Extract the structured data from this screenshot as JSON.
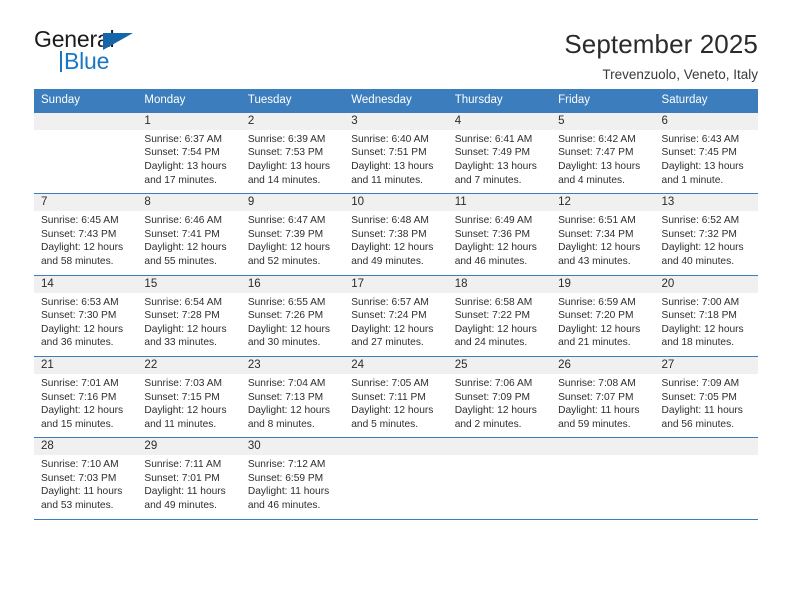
{
  "brand": {
    "name_top": "General",
    "name_bottom": "Blue",
    "accent_color": "#1878c4",
    "triangle_color": "#1565a8"
  },
  "header": {
    "title": "September 2025",
    "subtitle": "Trevenzuolo, Veneto, Italy"
  },
  "theme": {
    "header_row_bg": "#3b7dbd",
    "day_band_bg": "#f0f0f0",
    "cell_bg": "#ffffff",
    "text_color": "#2e2e2e"
  },
  "weekdays": [
    "Sunday",
    "Monday",
    "Tuesday",
    "Wednesday",
    "Thursday",
    "Friday",
    "Saturday"
  ],
  "calendar_data": {
    "type": "table",
    "title": "September 2025",
    "location": "Trevenzuolo, Veneto, Italy",
    "weeks": [
      [
        {
          "day": "",
          "sunrise": "",
          "sunset": "",
          "daylight_line1": "",
          "daylight_line2": ""
        },
        {
          "day": "1",
          "sunrise": "Sunrise: 6:37 AM",
          "sunset": "Sunset: 7:54 PM",
          "daylight_line1": "Daylight: 13 hours",
          "daylight_line2": "and 17 minutes."
        },
        {
          "day": "2",
          "sunrise": "Sunrise: 6:39 AM",
          "sunset": "Sunset: 7:53 PM",
          "daylight_line1": "Daylight: 13 hours",
          "daylight_line2": "and 14 minutes."
        },
        {
          "day": "3",
          "sunrise": "Sunrise: 6:40 AM",
          "sunset": "Sunset: 7:51 PM",
          "daylight_line1": "Daylight: 13 hours",
          "daylight_line2": "and 11 minutes."
        },
        {
          "day": "4",
          "sunrise": "Sunrise: 6:41 AM",
          "sunset": "Sunset: 7:49 PM",
          "daylight_line1": "Daylight: 13 hours",
          "daylight_line2": "and 7 minutes."
        },
        {
          "day": "5",
          "sunrise": "Sunrise: 6:42 AM",
          "sunset": "Sunset: 7:47 PM",
          "daylight_line1": "Daylight: 13 hours",
          "daylight_line2": "and 4 minutes."
        },
        {
          "day": "6",
          "sunrise": "Sunrise: 6:43 AM",
          "sunset": "Sunset: 7:45 PM",
          "daylight_line1": "Daylight: 13 hours",
          "daylight_line2": "and 1 minute."
        }
      ],
      [
        {
          "day": "7",
          "sunrise": "Sunrise: 6:45 AM",
          "sunset": "Sunset: 7:43 PM",
          "daylight_line1": "Daylight: 12 hours",
          "daylight_line2": "and 58 minutes."
        },
        {
          "day": "8",
          "sunrise": "Sunrise: 6:46 AM",
          "sunset": "Sunset: 7:41 PM",
          "daylight_line1": "Daylight: 12 hours",
          "daylight_line2": "and 55 minutes."
        },
        {
          "day": "9",
          "sunrise": "Sunrise: 6:47 AM",
          "sunset": "Sunset: 7:39 PM",
          "daylight_line1": "Daylight: 12 hours",
          "daylight_line2": "and 52 minutes."
        },
        {
          "day": "10",
          "sunrise": "Sunrise: 6:48 AM",
          "sunset": "Sunset: 7:38 PM",
          "daylight_line1": "Daylight: 12 hours",
          "daylight_line2": "and 49 minutes."
        },
        {
          "day": "11",
          "sunrise": "Sunrise: 6:49 AM",
          "sunset": "Sunset: 7:36 PM",
          "daylight_line1": "Daylight: 12 hours",
          "daylight_line2": "and 46 minutes."
        },
        {
          "day": "12",
          "sunrise": "Sunrise: 6:51 AM",
          "sunset": "Sunset: 7:34 PM",
          "daylight_line1": "Daylight: 12 hours",
          "daylight_line2": "and 43 minutes."
        },
        {
          "day": "13",
          "sunrise": "Sunrise: 6:52 AM",
          "sunset": "Sunset: 7:32 PM",
          "daylight_line1": "Daylight: 12 hours",
          "daylight_line2": "and 40 minutes."
        }
      ],
      [
        {
          "day": "14",
          "sunrise": "Sunrise: 6:53 AM",
          "sunset": "Sunset: 7:30 PM",
          "daylight_line1": "Daylight: 12 hours",
          "daylight_line2": "and 36 minutes."
        },
        {
          "day": "15",
          "sunrise": "Sunrise: 6:54 AM",
          "sunset": "Sunset: 7:28 PM",
          "daylight_line1": "Daylight: 12 hours",
          "daylight_line2": "and 33 minutes."
        },
        {
          "day": "16",
          "sunrise": "Sunrise: 6:55 AM",
          "sunset": "Sunset: 7:26 PM",
          "daylight_line1": "Daylight: 12 hours",
          "daylight_line2": "and 30 minutes."
        },
        {
          "day": "17",
          "sunrise": "Sunrise: 6:57 AM",
          "sunset": "Sunset: 7:24 PM",
          "daylight_line1": "Daylight: 12 hours",
          "daylight_line2": "and 27 minutes."
        },
        {
          "day": "18",
          "sunrise": "Sunrise: 6:58 AM",
          "sunset": "Sunset: 7:22 PM",
          "daylight_line1": "Daylight: 12 hours",
          "daylight_line2": "and 24 minutes."
        },
        {
          "day": "19",
          "sunrise": "Sunrise: 6:59 AM",
          "sunset": "Sunset: 7:20 PM",
          "daylight_line1": "Daylight: 12 hours",
          "daylight_line2": "and 21 minutes."
        },
        {
          "day": "20",
          "sunrise": "Sunrise: 7:00 AM",
          "sunset": "Sunset: 7:18 PM",
          "daylight_line1": "Daylight: 12 hours",
          "daylight_line2": "and 18 minutes."
        }
      ],
      [
        {
          "day": "21",
          "sunrise": "Sunrise: 7:01 AM",
          "sunset": "Sunset: 7:16 PM",
          "daylight_line1": "Daylight: 12 hours",
          "daylight_line2": "and 15 minutes."
        },
        {
          "day": "22",
          "sunrise": "Sunrise: 7:03 AM",
          "sunset": "Sunset: 7:15 PM",
          "daylight_line1": "Daylight: 12 hours",
          "daylight_line2": "and 11 minutes."
        },
        {
          "day": "23",
          "sunrise": "Sunrise: 7:04 AM",
          "sunset": "Sunset: 7:13 PM",
          "daylight_line1": "Daylight: 12 hours",
          "daylight_line2": "and 8 minutes."
        },
        {
          "day": "24",
          "sunrise": "Sunrise: 7:05 AM",
          "sunset": "Sunset: 7:11 PM",
          "daylight_line1": "Daylight: 12 hours",
          "daylight_line2": "and 5 minutes."
        },
        {
          "day": "25",
          "sunrise": "Sunrise: 7:06 AM",
          "sunset": "Sunset: 7:09 PM",
          "daylight_line1": "Daylight: 12 hours",
          "daylight_line2": "and 2 minutes."
        },
        {
          "day": "26",
          "sunrise": "Sunrise: 7:08 AM",
          "sunset": "Sunset: 7:07 PM",
          "daylight_line1": "Daylight: 11 hours",
          "daylight_line2": "and 59 minutes."
        },
        {
          "day": "27",
          "sunrise": "Sunrise: 7:09 AM",
          "sunset": "Sunset: 7:05 PM",
          "daylight_line1": "Daylight: 11 hours",
          "daylight_line2": "and 56 minutes."
        }
      ],
      [
        {
          "day": "28",
          "sunrise": "Sunrise: 7:10 AM",
          "sunset": "Sunset: 7:03 PM",
          "daylight_line1": "Daylight: 11 hours",
          "daylight_line2": "and 53 minutes."
        },
        {
          "day": "29",
          "sunrise": "Sunrise: 7:11 AM",
          "sunset": "Sunset: 7:01 PM",
          "daylight_line1": "Daylight: 11 hours",
          "daylight_line2": "and 49 minutes."
        },
        {
          "day": "30",
          "sunrise": "Sunrise: 7:12 AM",
          "sunset": "Sunset: 6:59 PM",
          "daylight_line1": "Daylight: 11 hours",
          "daylight_line2": "and 46 minutes."
        },
        {
          "day": "",
          "sunrise": "",
          "sunset": "",
          "daylight_line1": "",
          "daylight_line2": ""
        },
        {
          "day": "",
          "sunrise": "",
          "sunset": "",
          "daylight_line1": "",
          "daylight_line2": ""
        },
        {
          "day": "",
          "sunrise": "",
          "sunset": "",
          "daylight_line1": "",
          "daylight_line2": ""
        },
        {
          "day": "",
          "sunrise": "",
          "sunset": "",
          "daylight_line1": "",
          "daylight_line2": ""
        }
      ]
    ]
  }
}
